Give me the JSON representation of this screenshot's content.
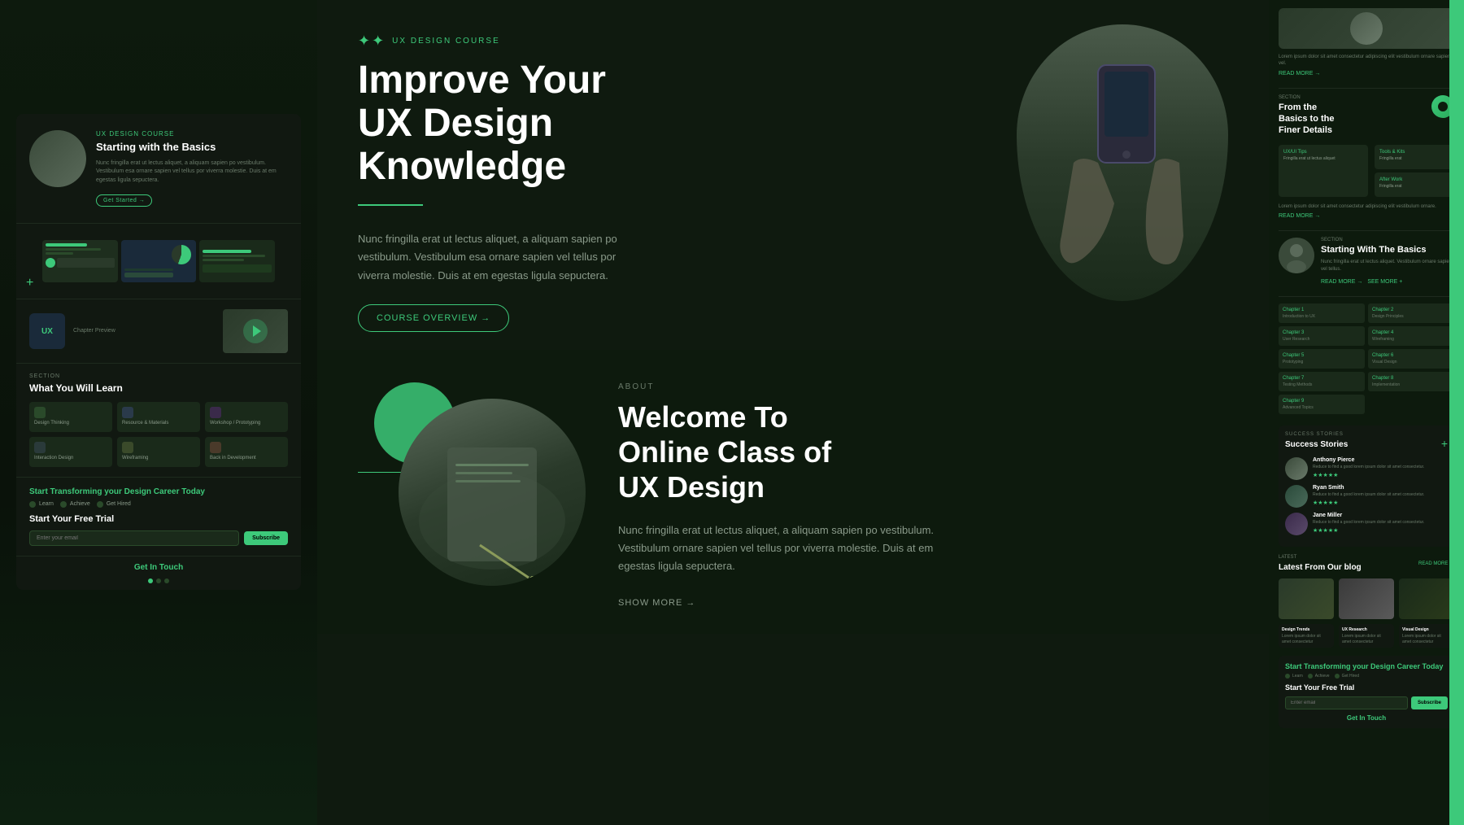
{
  "leftPanel": {
    "hero": {
      "tag": "UX Design Course",
      "title": "Starting with the Basics",
      "desc": "Nunc fringilla erat ut lectus aliquet, a aliquam sapien po vestibulum. Vestibulum esa ornare sapien vel tellus por viverra molestie. Duis at em egestas ligula sepuctera.",
      "btnLabel": "Get Started →"
    },
    "chapter": {
      "tag": "Chapter Preview",
      "uxLabel": "UX"
    },
    "learn": {
      "tag": "What You Will Learn",
      "items": [
        {
          "icon": "pencil",
          "text": "Design Thinking"
        },
        {
          "icon": "link",
          "text": "Resource & Materials"
        },
        {
          "icon": "grid",
          "text": "Workshop / Prototyping"
        },
        {
          "icon": "chart",
          "text": "Interaction Design"
        },
        {
          "icon": "layers",
          "text": "Wireframing"
        },
        {
          "icon": "book",
          "text": "Back in Development"
        }
      ]
    },
    "cta": {
      "title": "Start Transforming your Design Career Today",
      "badges": [
        "Learn",
        "Achieve",
        "Get Hired"
      ],
      "freeTrialLabel": "Start Your Free Trial",
      "inputPlaceholder": "Enter your email",
      "subscribeLabel": "Subscribe",
      "getInTouchLabel": "Get In Touch"
    },
    "pagination": {
      "dots": 3,
      "active": 0
    }
  },
  "mainContent": {
    "hero": {
      "tag": "UX DESIGN COURSE",
      "title": "Improve Your\nUX Design\nKnowledge",
      "desc": "Nunc fringilla erat ut lectus aliquet, a aliquam sapien po vestibulum. Vestibulum esa ornare sapien vel tellus por viverra molestie. Duis at em egestas ligula sepuctera.",
      "btnLabel": "COURSE OVERVIEW →"
    },
    "about": {
      "tag": "ABOUT",
      "title": "Welcome To\nOnline Class of\nUX Design",
      "desc": "Nunc fringilla erat ut lectus aliquet, a aliquam sapien po vestibulum. Vestibulum ornare sapien vel tellus por viverra molestie. Duis at em egestas ligula sepuctera.",
      "showMoreLabel": "SHOW MORE →"
    }
  },
  "rightPanel": {
    "course": {
      "tag": "From the\nBasics to the\nFiner Details",
      "subtitle": "Nunc fringilla erat ut lectus",
      "readMoreLabel": "READ MORE →"
    },
    "chapters": {
      "tag": "Chapter 1",
      "items": [
        {
          "num": "Chapter 1",
          "text": "Introduction to UX"
        },
        {
          "num": "Chapter 2",
          "text": "Design Principles"
        },
        {
          "num": "Chapter 3",
          "text": "User Research"
        },
        {
          "num": "Chapter 4",
          "text": "Wireframing"
        },
        {
          "num": "Chapter 5",
          "text": "Prototyping"
        },
        {
          "num": "Chapter 6",
          "text": "Visual Design"
        },
        {
          "num": "Chapter 7",
          "text": "Testing Methods"
        },
        {
          "num": "Chapter 8",
          "text": "Implementation"
        },
        {
          "num": "Chapter 9",
          "text": "Advanced Topics"
        }
      ]
    },
    "startingBasics": {
      "title": "Starting With The Basics",
      "desc": "Nunc fringilla erat ut lectus aliquet. Vestibulum ornare sapien vel tellus.",
      "readMoreLabel": "READ MORE → SEE MORE +"
    },
    "successStories": {
      "tag": "Success Stories",
      "stories": [
        {
          "name": "Anthony Pierce",
          "text": "Reduce to find a good lorem ipsum dolor sit amet consectetur.",
          "stars": 5
        },
        {
          "name": "Ryan Smith",
          "text": "Reduce to find a good lorem ipsum dolor sit amet consectetur.",
          "stars": 5
        },
        {
          "name": "Jane Miller",
          "text": "Reduce to find a good lorem ipsum dolor sit amet consectetur.",
          "stars": 5
        }
      ]
    },
    "blog": {
      "tag": "Latest From Our blog",
      "readMoreLabel": "READ MORE →",
      "posts": [
        {
          "title": "Design Trends",
          "text": "Lorem ipsum dolor sit amet consectetur"
        },
        {
          "title": "UX Research",
          "text": "Lorem ipsum dolor sit amet consectetur"
        },
        {
          "title": "Visual Design",
          "text": "Lorem ipsum dolor sit amet consectetur"
        }
      ]
    },
    "cta": {
      "title": "Start Transforming your Design Career Today",
      "badges": [
        "Learn",
        "Achieve",
        "Get Hired"
      ],
      "freeTrialLabel": "Start Your Free Trial",
      "inputPlaceholder": "Enter email",
      "subscribeLabel": "Subscribe",
      "getInTouchLabel": "Get In Touch"
    }
  }
}
